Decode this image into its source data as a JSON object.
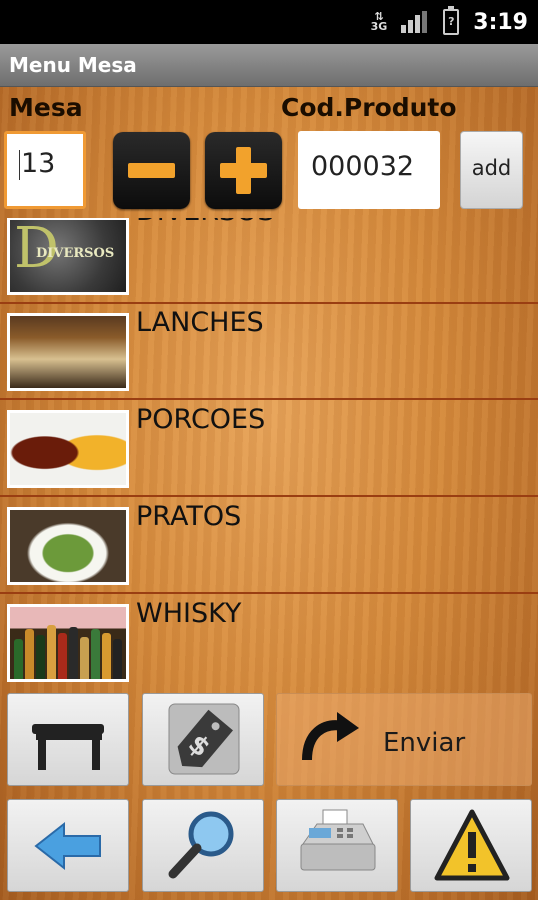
{
  "status_bar": {
    "network": "3G",
    "time": "3:19"
  },
  "title": "Menu Mesa",
  "labels": {
    "mesa": "Mesa",
    "cod_produto": "Cod.Produto"
  },
  "mesa_value": "13",
  "cod_value": "000032",
  "add_label": "add",
  "categories": [
    {
      "name": "DIVERSOS",
      "thumb_text": "DIVERSOS",
      "icon": "diversos-thumbnail"
    },
    {
      "name": "LANCHES",
      "icon": "burger-thumbnail"
    },
    {
      "name": "PORCOES",
      "icon": "fries-thumbnail"
    },
    {
      "name": "PRATOS",
      "icon": "salad-thumbnail"
    },
    {
      "name": "WHISKY",
      "icon": "bottles-thumbnail"
    }
  ],
  "bottom_buttons": {
    "enviar_label": "Enviar",
    "icons": [
      "table-icon",
      "price-tag-icon",
      "redo-arrow-icon",
      "back-arrow-icon",
      "search-icon",
      "cash-register-icon",
      "warning-icon"
    ]
  },
  "colors": {
    "accent": "#f2a22c",
    "divider": "#9a3e12"
  }
}
